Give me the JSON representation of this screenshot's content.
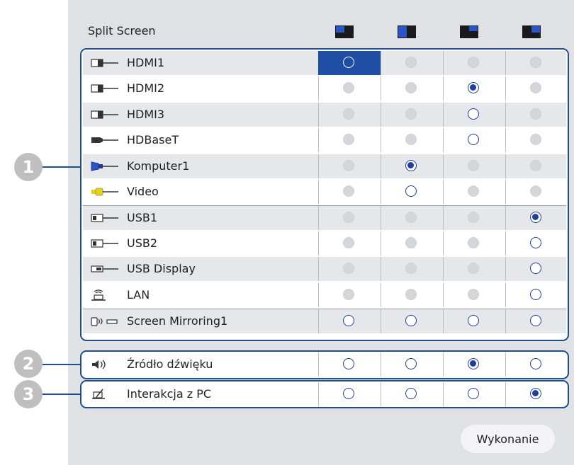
{
  "title": "Split Screen",
  "layouts": [
    {
      "icon": "layout-topleft-icon"
    },
    {
      "icon": "layout-left-icon"
    },
    {
      "icon": "layout-topright-icon"
    },
    {
      "icon": "layout-right-icon"
    }
  ],
  "sources": [
    {
      "label": "HDMI1",
      "icon": "hdmi-icon",
      "state": [
        "focus",
        "off",
        "off",
        "off"
      ]
    },
    {
      "label": "HDMI2",
      "icon": "hdmi-icon",
      "state": [
        "off",
        "off",
        "sel",
        "off"
      ]
    },
    {
      "label": "HDMI3",
      "icon": "hdmi-icon",
      "state": [
        "off",
        "off",
        "on",
        "off"
      ]
    },
    {
      "label": "HDBaseT",
      "icon": "hdbaset-icon",
      "state": [
        "off",
        "off",
        "on",
        "off"
      ]
    },
    {
      "label": "Komputer1",
      "icon": "computer-vga-icon",
      "state": [
        "off",
        "sel",
        "off",
        "off"
      ]
    },
    {
      "label": "Video",
      "icon": "video-icon",
      "state": [
        "off",
        "on",
        "off",
        "off"
      ]
    },
    {
      "label": "USB1",
      "icon": "usb-icon",
      "state": [
        "off",
        "off",
        "off",
        "sel"
      ]
    },
    {
      "label": "USB2",
      "icon": "usb-icon",
      "state": [
        "off",
        "off",
        "off",
        "on"
      ]
    },
    {
      "label": "USB Display",
      "icon": "usb-display-icon",
      "state": [
        "off",
        "off",
        "off",
        "on"
      ]
    },
    {
      "label": "LAN",
      "icon": "lan-icon",
      "state": [
        "off",
        "off",
        "off",
        "on"
      ]
    },
    {
      "label": "Screen Mirroring1",
      "icon": "screen-mirroring-icon",
      "state": [
        "on",
        "on",
        "on",
        "on"
      ]
    }
  ],
  "audio": {
    "label": "Źródło dźwięku",
    "icon": "speaker-icon",
    "state": [
      "on",
      "on",
      "sel",
      "on"
    ]
  },
  "interaction": {
    "label": "Interakcja z PC",
    "icon": "pen-icon",
    "state": [
      "on",
      "on",
      "on",
      "sel"
    ]
  },
  "callouts": [
    "1",
    "2",
    "3"
  ],
  "execute_label": "Wykonanie",
  "colors": {
    "accent": "#1f4ea5",
    "frame": "#1f4f8a",
    "panel": "#dfe1e5"
  }
}
